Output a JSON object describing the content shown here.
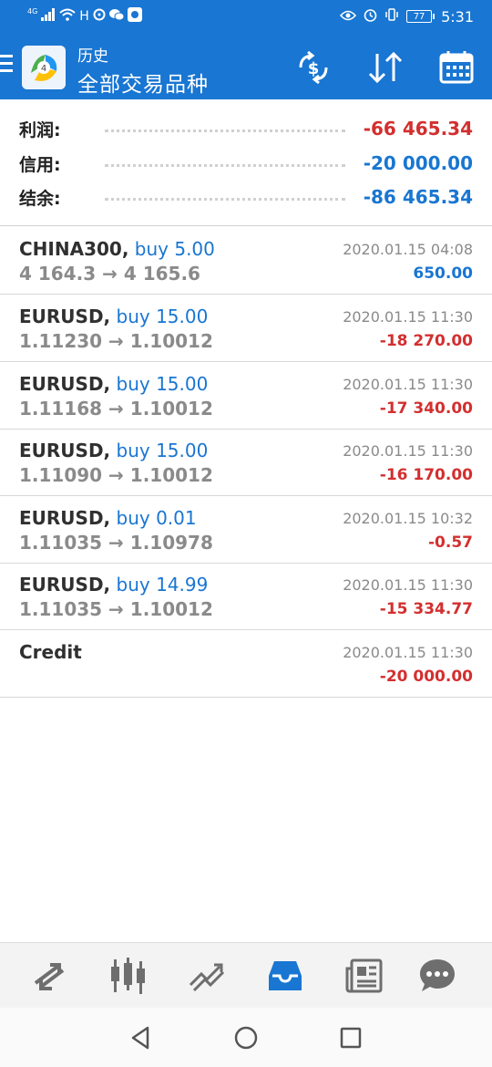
{
  "status_bar": {
    "network": "4G",
    "time": "5:31",
    "battery": "77"
  },
  "app_bar": {
    "title_small": "历史",
    "title_big": "全部交易品种"
  },
  "summary": [
    {
      "label": "利润:",
      "value": "-66 465.34",
      "color": "#d32f2f"
    },
    {
      "label": "信用:",
      "value": "-20 000.00",
      "color": "#1976d2"
    },
    {
      "label": "结余:",
      "value": "-86 465.34",
      "color": "#1976d2"
    }
  ],
  "trades": [
    {
      "symbol": "CHINA300,",
      "side": "buy 5.00",
      "prices": "4 164.3 → 4 165.6",
      "time": "2020.01.15 04:08",
      "profit": "650.00",
      "color": "#1976d2"
    },
    {
      "symbol": "EURUSD,",
      "side": "buy 15.00",
      "prices": "1.11230 → 1.10012",
      "time": "2020.01.15 11:30",
      "profit": "-18 270.00",
      "color": "#d32f2f"
    },
    {
      "symbol": "EURUSD,",
      "side": "buy 15.00",
      "prices": "1.11168 → 1.10012",
      "time": "2020.01.15 11:30",
      "profit": "-17 340.00",
      "color": "#d32f2f"
    },
    {
      "symbol": "EURUSD,",
      "side": "buy 15.00",
      "prices": "1.11090 → 1.10012",
      "time": "2020.01.15 11:30",
      "profit": "-16 170.00",
      "color": "#d32f2f"
    },
    {
      "symbol": "EURUSD,",
      "side": "buy 0.01",
      "prices": "1.11035 → 1.10978",
      "time": "2020.01.15 10:32",
      "profit": "-0.57",
      "color": "#d32f2f"
    },
    {
      "symbol": "EURUSD,",
      "side": "buy 14.99",
      "prices": "1.11035 → 1.10012",
      "time": "2020.01.15 11:30",
      "profit": "-15 334.77",
      "color": "#d32f2f"
    },
    {
      "symbol": "Credit",
      "side": "",
      "prices": "",
      "time": "2020.01.15 11:30",
      "profit": "-20 000.00",
      "color": "#d32f2f"
    }
  ],
  "icons": {
    "toolbar": [
      "currency-exchange-icon",
      "sort-icon",
      "calendar-icon"
    ],
    "bottom_nav": [
      "quotes-icon",
      "chart-icon",
      "trade-icon",
      "history-icon",
      "news-icon",
      "chat-icon"
    ],
    "active_nav": "history-icon"
  },
  "colors": {
    "accent": "#1976d2",
    "loss": "#d32f2f"
  }
}
